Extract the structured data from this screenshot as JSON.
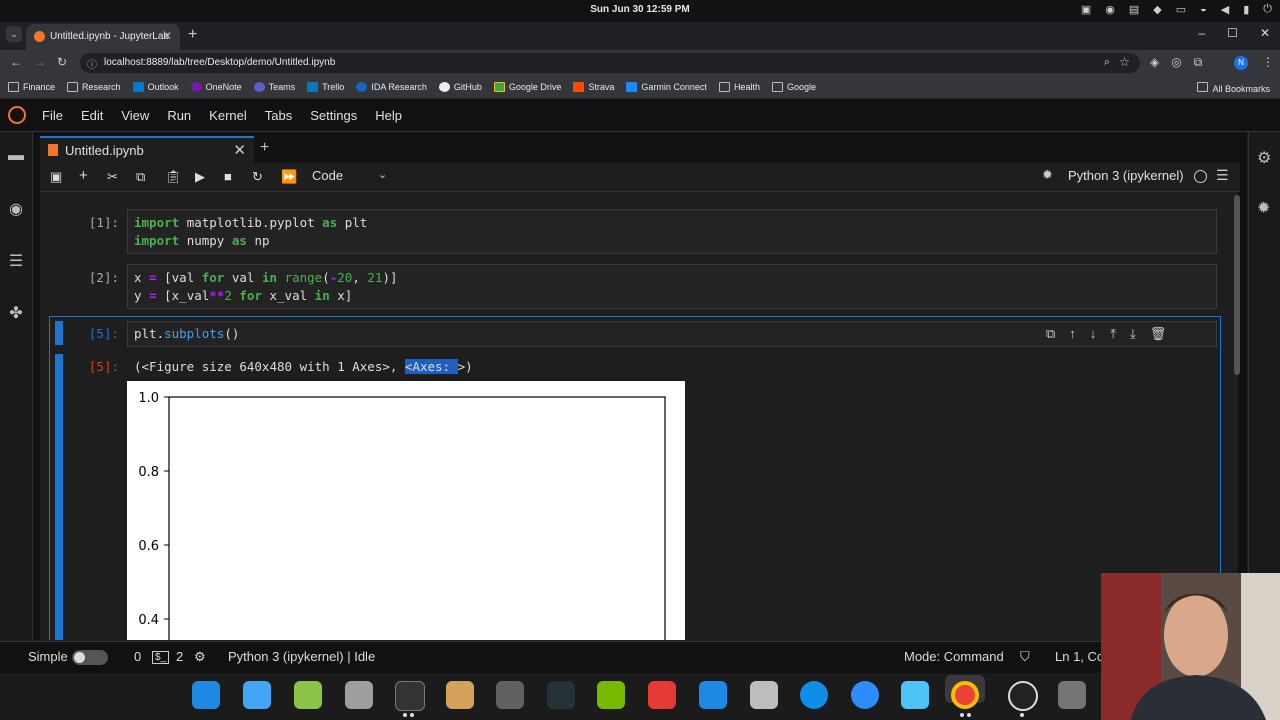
{
  "system": {
    "clock": "Sun Jun 30   12:59 PM"
  },
  "browser": {
    "tab_title": "Untitled.ipynb - JupyterLab",
    "url": "localhost:8889/lab/tree/Desktop/demo/Untitled.ipynb",
    "profile_initial": "N",
    "bookmarks": [
      "Finance",
      "Research",
      "Outlook",
      "OneNote",
      "Teams",
      "Trello",
      "IDA Research",
      "GitHub",
      "Google Drive",
      "Strava",
      "Garmin Connect",
      "Health",
      "Google"
    ],
    "all_bookmarks": "All Bookmarks"
  },
  "menu": [
    "File",
    "Edit",
    "View",
    "Run",
    "Kernel",
    "Tabs",
    "Settings",
    "Help"
  ],
  "document_tab": "Untitled.ipynb",
  "toolbar": {
    "cell_type": "Code",
    "kernel": "Python 3 (ipykernel)"
  },
  "cells": {
    "c1": {
      "prompt": "[1]:",
      "line1_kw": "import",
      "line1_mod": "matplotlib.pyplot",
      "line1_as": "as",
      "line1_alias": "plt",
      "line2_kw": "import",
      "line2_mod": "numpy",
      "line2_as": "as",
      "line2_alias": "np"
    },
    "c2": {
      "prompt": "[2]:"
    },
    "c3": {
      "prompt": "[5]:",
      "out_prompt": "[5]:",
      "output_a": "(<Figure size 640x480 with 1 Axes>, ",
      "output_sel": "<Axes: ",
      "output_b": ">)"
    }
  },
  "plot": {
    "y_ticks": [
      "1.0",
      "0.8",
      "0.6",
      "0.4"
    ]
  },
  "status": {
    "mode_label": "Simple",
    "terminals": "0",
    "kernels": "2",
    "kernel_state": "Python 3 (ipykernel) | Idle",
    "mode": "Mode: Command",
    "position": "Ln 1, Col"
  }
}
